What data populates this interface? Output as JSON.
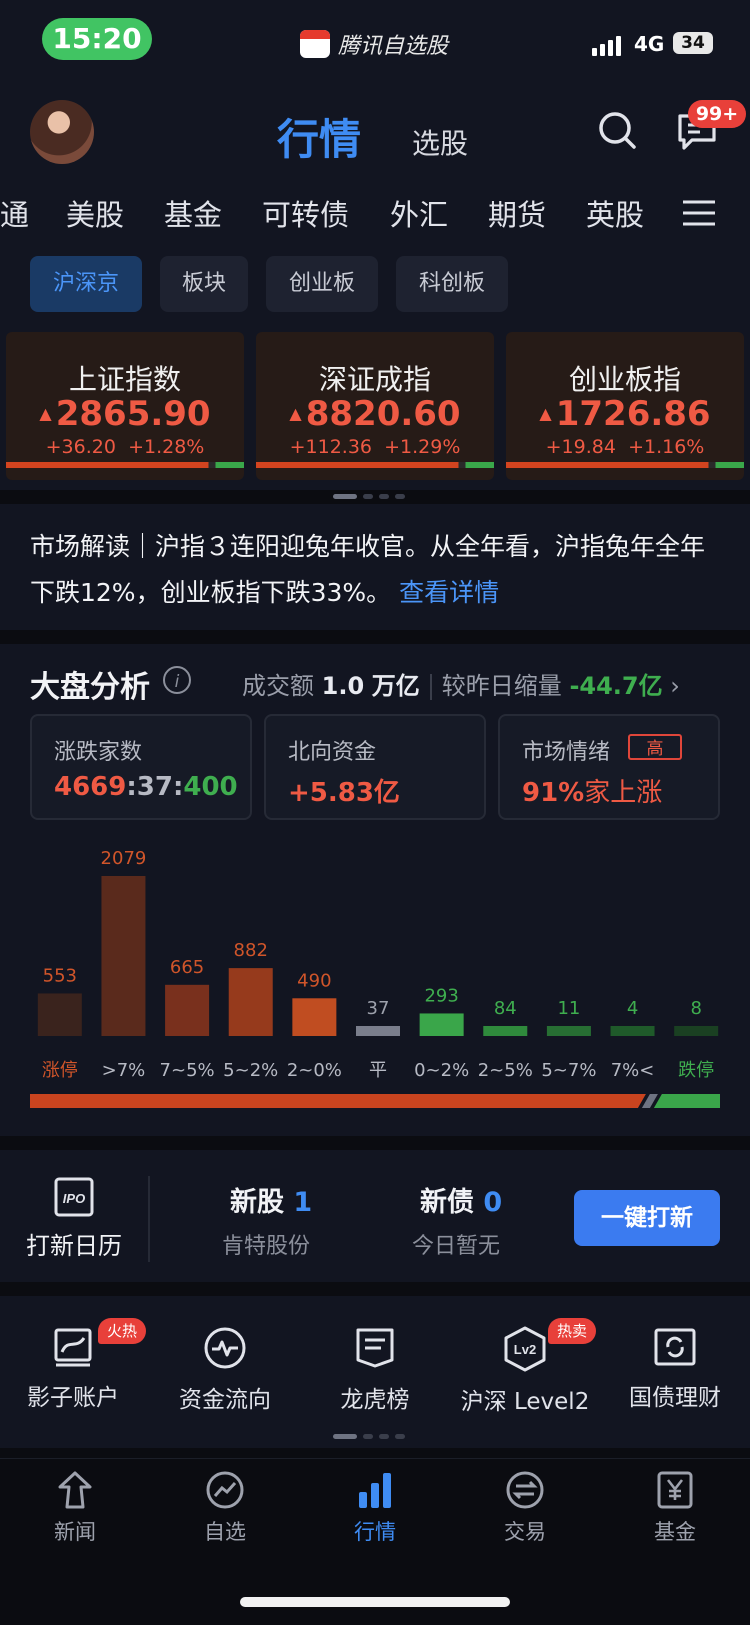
{
  "status": {
    "time": "15:20",
    "app_name": "腾讯自选股",
    "network": "4G",
    "battery": "34"
  },
  "header": {
    "active_tab": "行情",
    "tab2": "选股",
    "badge": "99+"
  },
  "categories": [
    "通",
    "美股",
    "基金",
    "可转债",
    "外汇",
    "期货",
    "英股"
  ],
  "sub_tabs": [
    "沪深京",
    "板块",
    "创业板",
    "科创板"
  ],
  "indices": [
    {
      "name": "上证指数",
      "price": "2865.90",
      "change": "+36.20",
      "pct": "+1.28%"
    },
    {
      "name": "深证成指",
      "price": "8820.60",
      "change": "+112.36",
      "pct": "+1.29%"
    },
    {
      "name": "创业板指",
      "price": "1726.86",
      "change": "+19.84",
      "pct": "+1.16%"
    }
  ],
  "market_read": {
    "text": "市场解读｜沪指３连阳迎兔年收官。从全年看，沪指兔年全年下跌12%，创业板指下跌33%。",
    "link": "查看详情"
  },
  "analysis": {
    "title": "大盘分析",
    "volume_label": "成交额",
    "volume_value": "1.0",
    "volume_unit": "万亿",
    "compare_label": "较昨日缩量",
    "compare_value": "-44.7亿",
    "boxes": {
      "breadth": {
        "label": "涨跌家数",
        "up": "4669",
        "flat": "37",
        "down": "400"
      },
      "north": {
        "label": "北向资金",
        "value": "+5.83亿"
      },
      "sentiment": {
        "label": "市场情绪",
        "tag": "高",
        "value": "91%",
        "suffix": "家上涨"
      }
    }
  },
  "chart_data": {
    "type": "bar",
    "categories": [
      "涨停",
      ">7%",
      "7~5%",
      "5~2%",
      "2~0%",
      "平",
      "0~2%",
      "2~5%",
      "5~7%",
      "7%<",
      "跌停"
    ],
    "values": [
      553,
      2079,
      665,
      882,
      490,
      37,
      293,
      84,
      11,
      4,
      8
    ],
    "colors": [
      "#3a231d",
      "#5a2a1c",
      "#79301d",
      "#963a1c",
      "#c04d21",
      "#7a7e8c",
      "#3aa64a",
      "#2f8a3c",
      "#276e33",
      "#1f5a2a",
      "#1a4022"
    ],
    "label_colors": [
      "#d0552a",
      "#d0552a",
      "#d0552a",
      "#d0552a",
      "#d0552a",
      "#9ea2ad",
      "#3fae4f",
      "#3fae4f",
      "#3fae4f",
      "#3fae4f",
      "#3fae4f"
    ],
    "up_ratio": 0.91
  },
  "ipo": {
    "calendar": "打新日历",
    "new_stock": "新股",
    "new_stock_count": "1",
    "new_stock_name": "肯特股份",
    "new_bond": "新债",
    "new_bond_count": "0",
    "new_bond_name": "今日暂无",
    "button": "一键打新"
  },
  "tools": [
    {
      "label": "影子账户",
      "tag": "火热"
    },
    {
      "label": "资金流向"
    },
    {
      "label": "龙虎榜"
    },
    {
      "label": "沪深 Level2",
      "tag": "热卖"
    },
    {
      "label": "国债理财"
    }
  ],
  "nav": [
    {
      "label": "新闻"
    },
    {
      "label": "自选"
    },
    {
      "label": "行情",
      "active": true
    },
    {
      "label": "交易"
    },
    {
      "label": "基金"
    }
  ]
}
